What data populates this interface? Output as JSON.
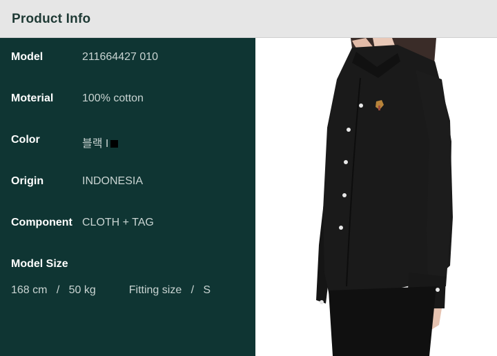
{
  "header": {
    "title": "Product Info"
  },
  "specs": [
    {
      "label": "Model",
      "value": "211664427 010"
    },
    {
      "label": "Moterial",
      "value": "100% cotton"
    },
    {
      "label": "Color",
      "value": "블랙 I"
    },
    {
      "label": "Origin",
      "value": "INDONESIA"
    },
    {
      "label": "Component",
      "value": "CLOTH + TAG"
    }
  ],
  "model_size": {
    "label": "Model Size",
    "height": "168 cm",
    "sep": "/",
    "weight": "50 kg",
    "fitting_label": "Fitting size",
    "fitting_value": "S"
  },
  "colors": {
    "panel_bg": "#0f3533",
    "header_bg": "#e6e6e6",
    "swatch": "#000000"
  }
}
